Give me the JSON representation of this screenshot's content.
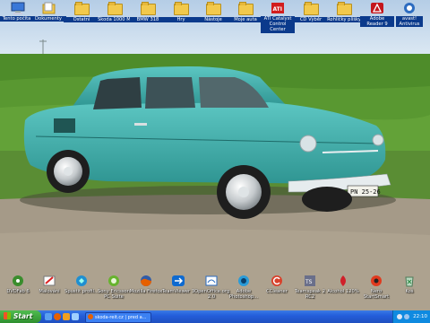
{
  "desktop": {
    "top_icons": [
      {
        "label": "Tento počítač",
        "icon": "computer-icon"
      },
      {
        "label": "Dokumenty",
        "icon": "documents-icon"
      },
      {
        "label": "Ostatní",
        "icon": "folder-icon"
      },
      {
        "label": "Škoda 1000 MB",
        "icon": "folder-icon"
      },
      {
        "label": "BMW 318",
        "icon": "folder-icon"
      },
      {
        "label": "Hry",
        "icon": "folder-icon"
      },
      {
        "label": "Nástoje",
        "icon": "folder-icon"
      },
      {
        "label": "Moje auta",
        "icon": "folder-icon"
      },
      {
        "label": "ATI Catalyst Control Center",
        "icon": "ati-icon"
      },
      {
        "label": "CD Výběr",
        "icon": "folder-icon"
      },
      {
        "label": "Rohlíčky plíšky",
        "icon": "folder-icon"
      },
      {
        "label": "Adobe Reader 9",
        "icon": "adobe-reader-icon"
      },
      {
        "label": "avast! Antivirus",
        "icon": "avast-icon"
      }
    ],
    "bottom_icons": [
      {
        "label": "DVDFab 6",
        "icon": "dvdfab-icon"
      },
      {
        "label": "Malování",
        "icon": "paint-icon"
      },
      {
        "label": "Spustit profil...",
        "icon": "profile-icon"
      },
      {
        "label": "Sony Ericsson PC Suite",
        "icon": "sony-ericsson-icon"
      },
      {
        "label": "Mozilla Firefox",
        "icon": "firefox-icon"
      },
      {
        "label": "TeamViewer 3",
        "icon": "teamviewer-icon"
      },
      {
        "label": "OpenOffice.org 2.0",
        "icon": "openoffice-icon"
      },
      {
        "label": "Adobe Photoshop...",
        "icon": "photoshop-icon"
      },
      {
        "label": "CCleaner",
        "icon": "ccleaner-icon"
      },
      {
        "label": "Teamspeak 2 RC2",
        "icon": "teamspeak-icon"
      },
      {
        "label": "Alcohol 120%",
        "icon": "alcohol-icon"
      },
      {
        "label": "Nero StartSmart",
        "icon": "nero-icon"
      },
      {
        "label": "Koš",
        "icon": "recycle-bin-icon"
      }
    ],
    "plate": "PN 25-26"
  },
  "taskbar": {
    "start_label": "Start",
    "task_label": "skoda-reit.cz | pred a...",
    "clock": "22:10"
  },
  "colors": {
    "taskbar": "#245edb",
    "start": "#3a9f3a",
    "car": "#45b3b0"
  }
}
